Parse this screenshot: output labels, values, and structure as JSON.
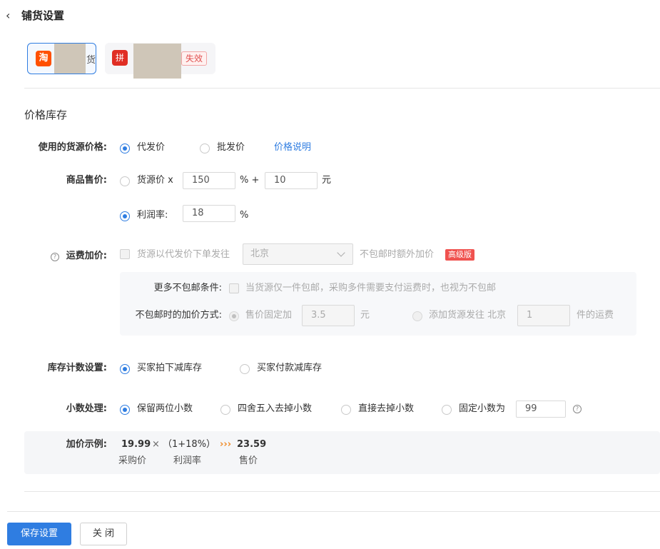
{
  "header": {
    "back_icon": "chevron-left-icon",
    "title": "铺货设置"
  },
  "stores": {
    "taobao": {
      "logo_char": "淘",
      "tail": "货"
    },
    "pdd": {
      "logo_char": "拼",
      "badge": "失效"
    }
  },
  "section": {
    "title": "价格库存"
  },
  "source_price": {
    "label": "使用的货源价格:",
    "options": [
      "代发价",
      "批发价"
    ],
    "selected": "代发价",
    "link": "价格说明"
  },
  "sale_price": {
    "label": "商品售价:",
    "opt1_prefix": "货源价 x",
    "multiplier": "150",
    "percent_plus": "% +",
    "addend": "10",
    "unit": "元",
    "opt2_label": "利润率:",
    "profit_rate": "18",
    "percent": "%",
    "selected": "利润率"
  },
  "shipping": {
    "label": "运费加价:",
    "checkbox_text": "货源以代发价下单发往",
    "region": "北京",
    "suffix": "不包邮时额外加价",
    "badge": "高级版",
    "more_label": "更多不包邮条件:",
    "more_text": "当货源仅一件包邮，采购多件需要支付运费时，也视为不包邮",
    "method_label": "不包邮时的加价方式:",
    "method1": "售价固定加",
    "fixed_value": "3.5",
    "method1_unit": "元",
    "method2": "添加货源发往 北京",
    "count_value": "1",
    "method2_suffix": "件的运费"
  },
  "stock": {
    "label": "库存计数设置:",
    "options": [
      "买家拍下减库存",
      "买家付款减库存"
    ],
    "selected": "买家拍下减库存"
  },
  "decimal": {
    "label": "小数处理:",
    "options": [
      "保留两位小数",
      "四舍五入去掉小数",
      "直接去掉小数",
      "固定小数为"
    ],
    "selected": "保留两位小数",
    "fixed_value": "99"
  },
  "example": {
    "label": "加价示例:",
    "purchase": "19.99",
    "times": "×",
    "formula": "（1+18%）",
    "arrow": "›››",
    "result": "23.59",
    "purchase_caption": "采购价",
    "profit_caption": "利润率",
    "sale_caption": "售价"
  },
  "footer": {
    "save": "保存设置",
    "close": "关 闭"
  },
  "colors": {
    "primary": "#2f7de1",
    "badge_red": "#f0524f",
    "taobao": "#ff5000",
    "pdd": "#e02e24"
  }
}
